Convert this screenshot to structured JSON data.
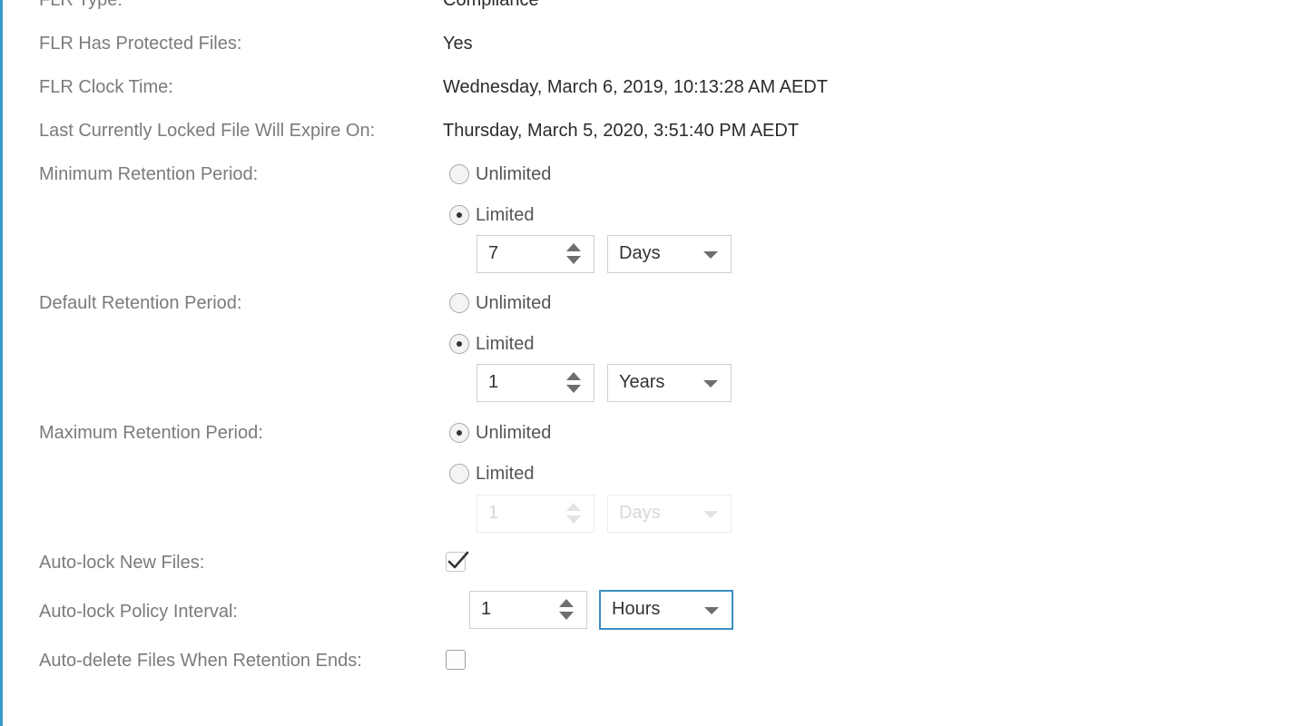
{
  "fields": {
    "flr_type": {
      "label": "FLR Type:",
      "value": "Compliance"
    },
    "flr_has_protected_files": {
      "label": "FLR Has Protected Files:",
      "value": "Yes"
    },
    "flr_clock_time": {
      "label": "FLR Clock Time:",
      "value": "Wednesday, March 6, 2019, 10:13:28 AM AEDT"
    },
    "last_locked_expire": {
      "label": "Last Currently Locked File Will Expire On:",
      "value": "Thursday, March 5, 2020, 3:51:40 PM AEDT"
    }
  },
  "minimum_retention": {
    "label": "Minimum Retention Period:",
    "options": [
      "Unlimited",
      "Limited"
    ],
    "selected": "Limited",
    "amount": "7",
    "unit": "Days"
  },
  "default_retention": {
    "label": "Default Retention Period:",
    "options": [
      "Unlimited",
      "Limited"
    ],
    "selected": "Limited",
    "amount": "1",
    "unit": "Years"
  },
  "maximum_retention": {
    "label": "Maximum Retention Period:",
    "options": [
      "Unlimited",
      "Limited"
    ],
    "selected": "Unlimited",
    "amount": "1",
    "unit": "Days"
  },
  "auto_lock_new_files": {
    "label": "Auto-lock New Files:",
    "checked": true
  },
  "auto_lock_policy_interval": {
    "label": "Auto-lock Policy Interval:",
    "amount": "1",
    "unit": "Hours"
  },
  "auto_delete_files": {
    "label": "Auto-delete Files When Retention Ends:",
    "checked": false
  },
  "colors": {
    "frame_accent": "#3a9ac9",
    "label_text": "#7b7b7b",
    "value_text": "#2b2b2b",
    "focus_border": "#3a8fc4"
  },
  "icons": [
    "radio-button",
    "checkmark-icon",
    "spinner-arrows-icon",
    "dropdown-caret-icon"
  ]
}
